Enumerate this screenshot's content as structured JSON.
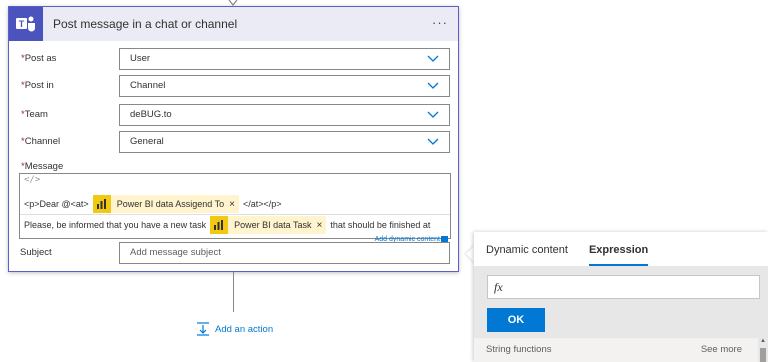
{
  "card": {
    "title": "Post message in a chat or channel",
    "more_label": "···"
  },
  "fields": [
    {
      "label": "Post as",
      "required_mark": "*",
      "value": "User"
    },
    {
      "label": "Post in",
      "required_mark": "*",
      "value": "Channel"
    },
    {
      "label": "Team",
      "required_mark": "*",
      "value": "deBUG.to"
    },
    {
      "label": "Channel",
      "required_mark": "*",
      "value": "General"
    }
  ],
  "message": {
    "label": "Message",
    "required_mark": "*",
    "code_icon": "</>",
    "line1_before": "<p>Dear @<at>",
    "line1_token": "Power BI data Assigend To",
    "line1_after": "</at></p>",
    "line2_before": "Please, be informed that you have a new task",
    "line2_token": "Power BI data Task",
    "line2_after": "that should be finished at",
    "token_close": "×",
    "add_dynamic": "Add dynamic content"
  },
  "subject": {
    "label": "Subject",
    "placeholder": "Add message subject"
  },
  "add_action": "Add an action",
  "panel": {
    "tabs": [
      "Dynamic content",
      "Expression"
    ],
    "active_tab": "Expression",
    "fx_label": "fx",
    "ok_label": "OK",
    "functions_label": "String functions",
    "see_more": "See more"
  },
  "colors": {
    "accent": "#5b5fc7",
    "teams": "#4b53bc",
    "token_bg": "#fff4ce",
    "token_icon": "#f2c811",
    "link": "#0078d4"
  }
}
